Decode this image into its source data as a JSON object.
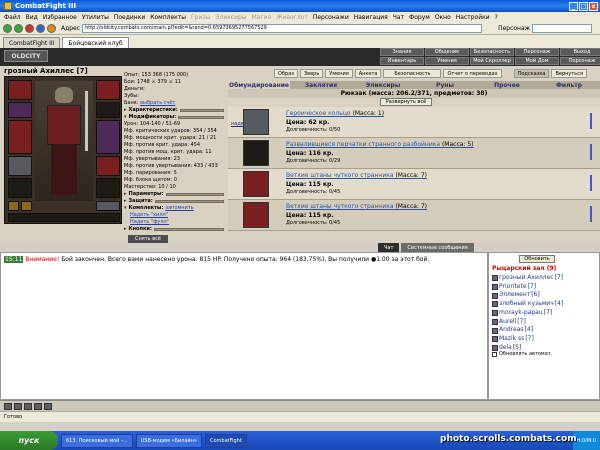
{
  "window": {
    "title": "CombatFight III"
  },
  "menu": {
    "items": [
      "Файл",
      "Вид",
      "Избранное",
      "Утилиты",
      "Поединки",
      "Комплекты",
      "Гризы",
      "Эликсиры",
      "Магия",
      "Живоглот",
      "Персонажи",
      "Навигация",
      "Чат",
      "Форум",
      "Окно",
      "Настройки",
      "?"
    ]
  },
  "address": {
    "label": "Адрес",
    "url": "http://oldcity.combats.com/main.pl?edit=&rand=0.65973695277567529",
    "search_label": "Персонаж"
  },
  "browser_tabs": [
    "CombatFight III",
    "Бойцовский клуб"
  ],
  "game": {
    "logo": "OLDCITY",
    "top_nav": [
      "Знания",
      "Общение",
      "Безопасность",
      "Персонаж",
      "Выход",
      "Инвентарь",
      "Умения",
      "Мой Скроллер",
      "Мой Дом",
      "Персонаж"
    ]
  },
  "player": {
    "name": "грозный Ахиллес",
    "level": "[7]",
    "stats": {
      "exp": "Опыт: 153 368 (175 000)",
      "hp": "Бои: 1748 ⚔ 379 ⚔ 11",
      "money": "Деньги: ",
      "teeth": "Зубы: ",
      "bank": "Банк:",
      "bank_link": "выбрать счёт"
    },
    "sections": {
      "characteristics": "Характеристики:",
      "modifiers": "Модификаторы:",
      "params": "Параметры:",
      "weapons": "Защита:",
      "kits": "Комплекты:",
      "buttons": "Кнопки:"
    },
    "mods": [
      "Урон: 104-140 / 51-69",
      "Мф. критических ударов: 354 / 354",
      "Мф. мощности крит. удара: 21 / 21",
      "Мф. против крит. удара: 454",
      "Мф. против мощ. крит. удара: 11",
      "Мф. увертывания: 23",
      "Мф. против увертывания: 433 / 433",
      "Мф. парирования: 5",
      "Мф. блока щитом: 0",
      "Мастерство: 10 / 10"
    ],
    "kits": [
      "Надеть \"хилл\"",
      "Надеть \"фулл\""
    ],
    "kits_link": "запомнить",
    "undress_btn": "Снять всё"
  },
  "inventory": {
    "buttons": [
      "Образ",
      "Зверь",
      "Умения",
      "Анкета",
      "Безопасность",
      "Отчет о переводах",
      "Подсказка",
      "Вернуться"
    ],
    "tabs": [
      "Обмундирование",
      "Заклятия",
      "Эликсиры",
      "Руны",
      "Прочее",
      "Фильтр"
    ],
    "backpack": "Рюкзак (масса: 206.2/371, предметов: 38)",
    "expand": "Развернуть всё",
    "items": [
      {
        "action": "надеть",
        "name": "Героическое кольцо",
        "mass": "(Масса: 1)",
        "price": "",
        "dur": "Долговечность: 0/50"
      },
      {
        "action": "",
        "name": "Развалившиеся перчатки странного разбойника",
        "mass": "(Масса: 5)",
        "price": "Цена: 116 кр.",
        "dur": "Долговечность: 0/29"
      },
      {
        "action": "",
        "name": "Ветхие штаны чуткого странника",
        "mass": "(Масса: 7)",
        "price": "Цена: 115 кр.",
        "dur": "Долговечность: 0/45"
      },
      {
        "action": "",
        "name": "Ветхие штаны чуткого странника",
        "mass": "(Масса: 7)",
        "price": "Цена: 115 кр.",
        "dur": "Долговечность: 0/45"
      }
    ],
    "first_price": "Цена: 62 кр."
  },
  "chat": {
    "tabs": [
      "Чат",
      "Системные сообщения"
    ],
    "time": "15:11",
    "warn": "Внимание!",
    "message": " Бой закончен. Всего вами нанесено урона: 815 HP. Получено опыта: 964 (183.75%). Вы получили ●1.00 за этот бой."
  },
  "room": {
    "refresh": "Обновить",
    "title": "Рыцарский зал (9)",
    "users": [
      {
        "name": "грозный Ахиллес",
        "lvl": "[7]"
      },
      {
        "name": "Prioritete",
        "lvl": "[7]"
      },
      {
        "name": "Эллемент",
        "lvl": "[6]"
      },
      {
        "name": "злобный кузьмич",
        "lvl": "[4]"
      },
      {
        "name": "morayk-papau",
        "lvl": "[7]"
      },
      {
        "name": "Aurell",
        "lvl": "[7]"
      },
      {
        "name": "Andreas",
        "lvl": "[4]"
      },
      {
        "name": "Mazik ss",
        "lvl": "[7]"
      },
      {
        "name": "dela",
        "lvl": "[5]"
      }
    ],
    "auto": "Обновлять автомат."
  },
  "status": {
    "text": "Готово"
  },
  "taskbar": {
    "start": "пуск",
    "tasks": [
      "613. Поисковый мой -...",
      "USB-модем «Билайн»",
      "CombatFight"
    ],
    "tray": "H:0/M:0"
  },
  "watermark": "photo.scrolls.combats.com"
}
